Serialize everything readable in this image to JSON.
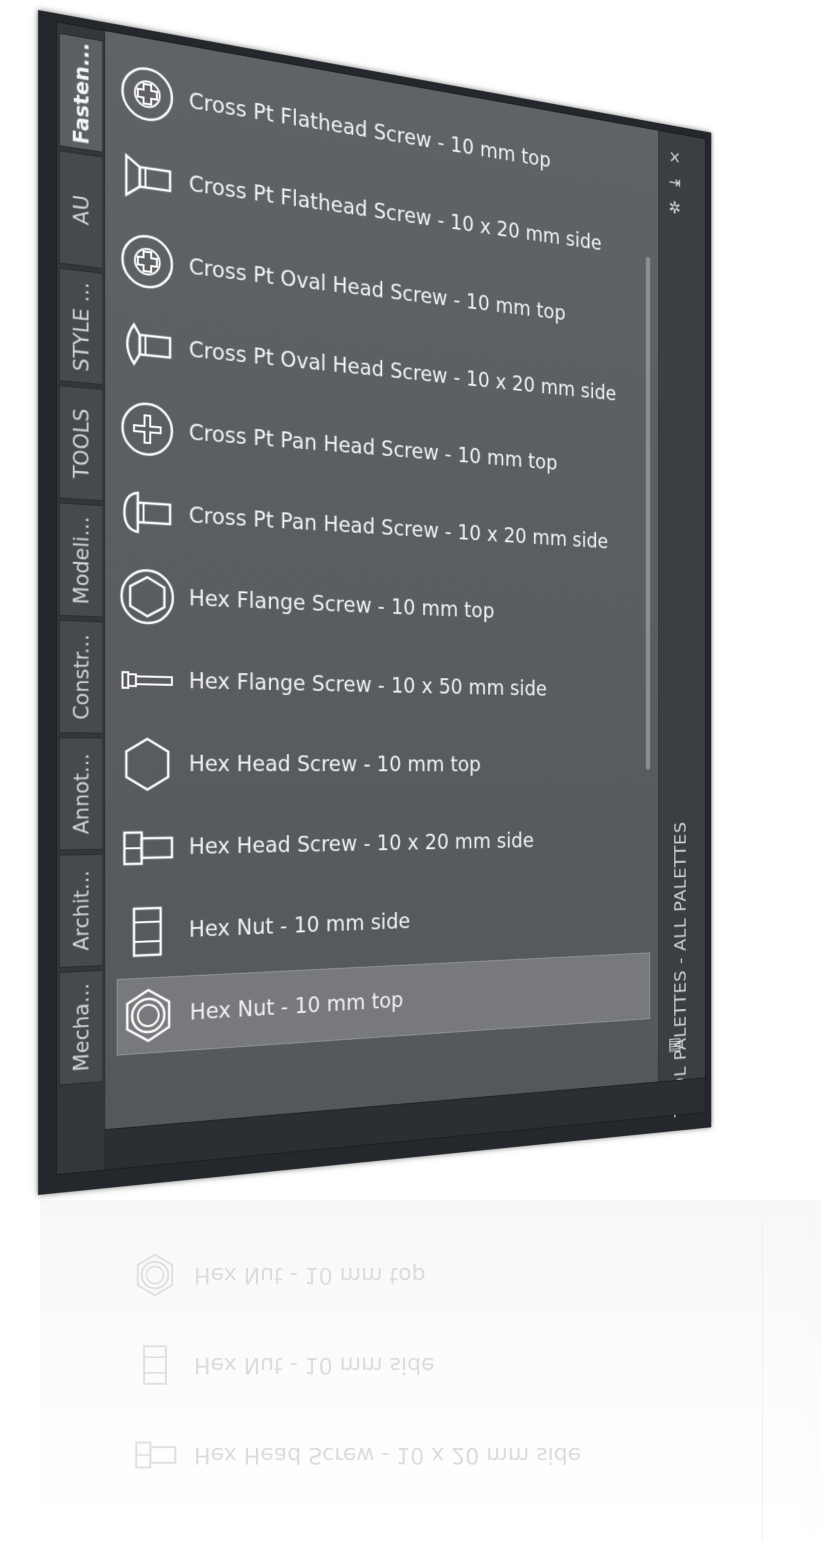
{
  "tabs": [
    {
      "label": "Fasten...",
      "active": true
    },
    {
      "label": "AU",
      "active": false
    },
    {
      "label": "STYLE ...",
      "active": false
    },
    {
      "label": "TOOLS",
      "active": false
    },
    {
      "label": "Modeli...",
      "active": false
    },
    {
      "label": "Constr...",
      "active": false
    },
    {
      "label": "Annot...",
      "active": false
    },
    {
      "label": "Archit...",
      "active": false
    },
    {
      "label": "Mecha...",
      "active": false
    }
  ],
  "items": [
    {
      "label": "Cross Pt Flathead Screw - 10 mm top",
      "icon": "cross-head-top-icon"
    },
    {
      "label": "Cross Pt Flathead Screw - 10 x 20 mm side",
      "icon": "flathead-side-icon"
    },
    {
      "label": "Cross Pt Oval Head Screw - 10 mm top",
      "icon": "cross-head-top-icon"
    },
    {
      "label": "Cross Pt Oval Head Screw - 10 x 20 mm side",
      "icon": "oval-head-side-icon"
    },
    {
      "label": "Cross Pt Pan Head Screw - 10 mm top",
      "icon": "pan-head-top-icon"
    },
    {
      "label": "Cross Pt Pan Head Screw - 10 x 20 mm side",
      "icon": "pan-head-side-icon"
    },
    {
      "label": "Hex Flange Screw - 10 mm top",
      "icon": "hex-flange-top-icon"
    },
    {
      "label": "Hex Flange Screw - 10 x 50 mm side",
      "icon": "hex-flange-side-icon"
    },
    {
      "label": "Hex Head Screw - 10 mm top",
      "icon": "hex-head-top-icon"
    },
    {
      "label": "Hex Head Screw - 10 x 20 mm side",
      "icon": "hex-head-side-icon"
    },
    {
      "label": "Hex Nut - 10 mm side",
      "icon": "hex-nut-side-icon"
    },
    {
      "label": "Hex Nut - 10 mm top",
      "icon": "hex-nut-top-icon",
      "selected": true
    }
  ],
  "side": {
    "title": "TOOL PALETTES - ALL PALETTES",
    "close_icon": "×",
    "autohide_icon": "⇥",
    "properties_icon": "✲",
    "palette_icon": "▤"
  },
  "reflection": {
    "rows": [
      "Hex Nut - 10 mm top",
      "Hex Nut - 10 mm side",
      "Hex Head Screw - 10 x 20 mm side"
    ]
  },
  "colors": {
    "frame": "#24282d",
    "content_bg": "#5a5d60",
    "selected": "#77797c",
    "text": "#f1f2f3"
  }
}
